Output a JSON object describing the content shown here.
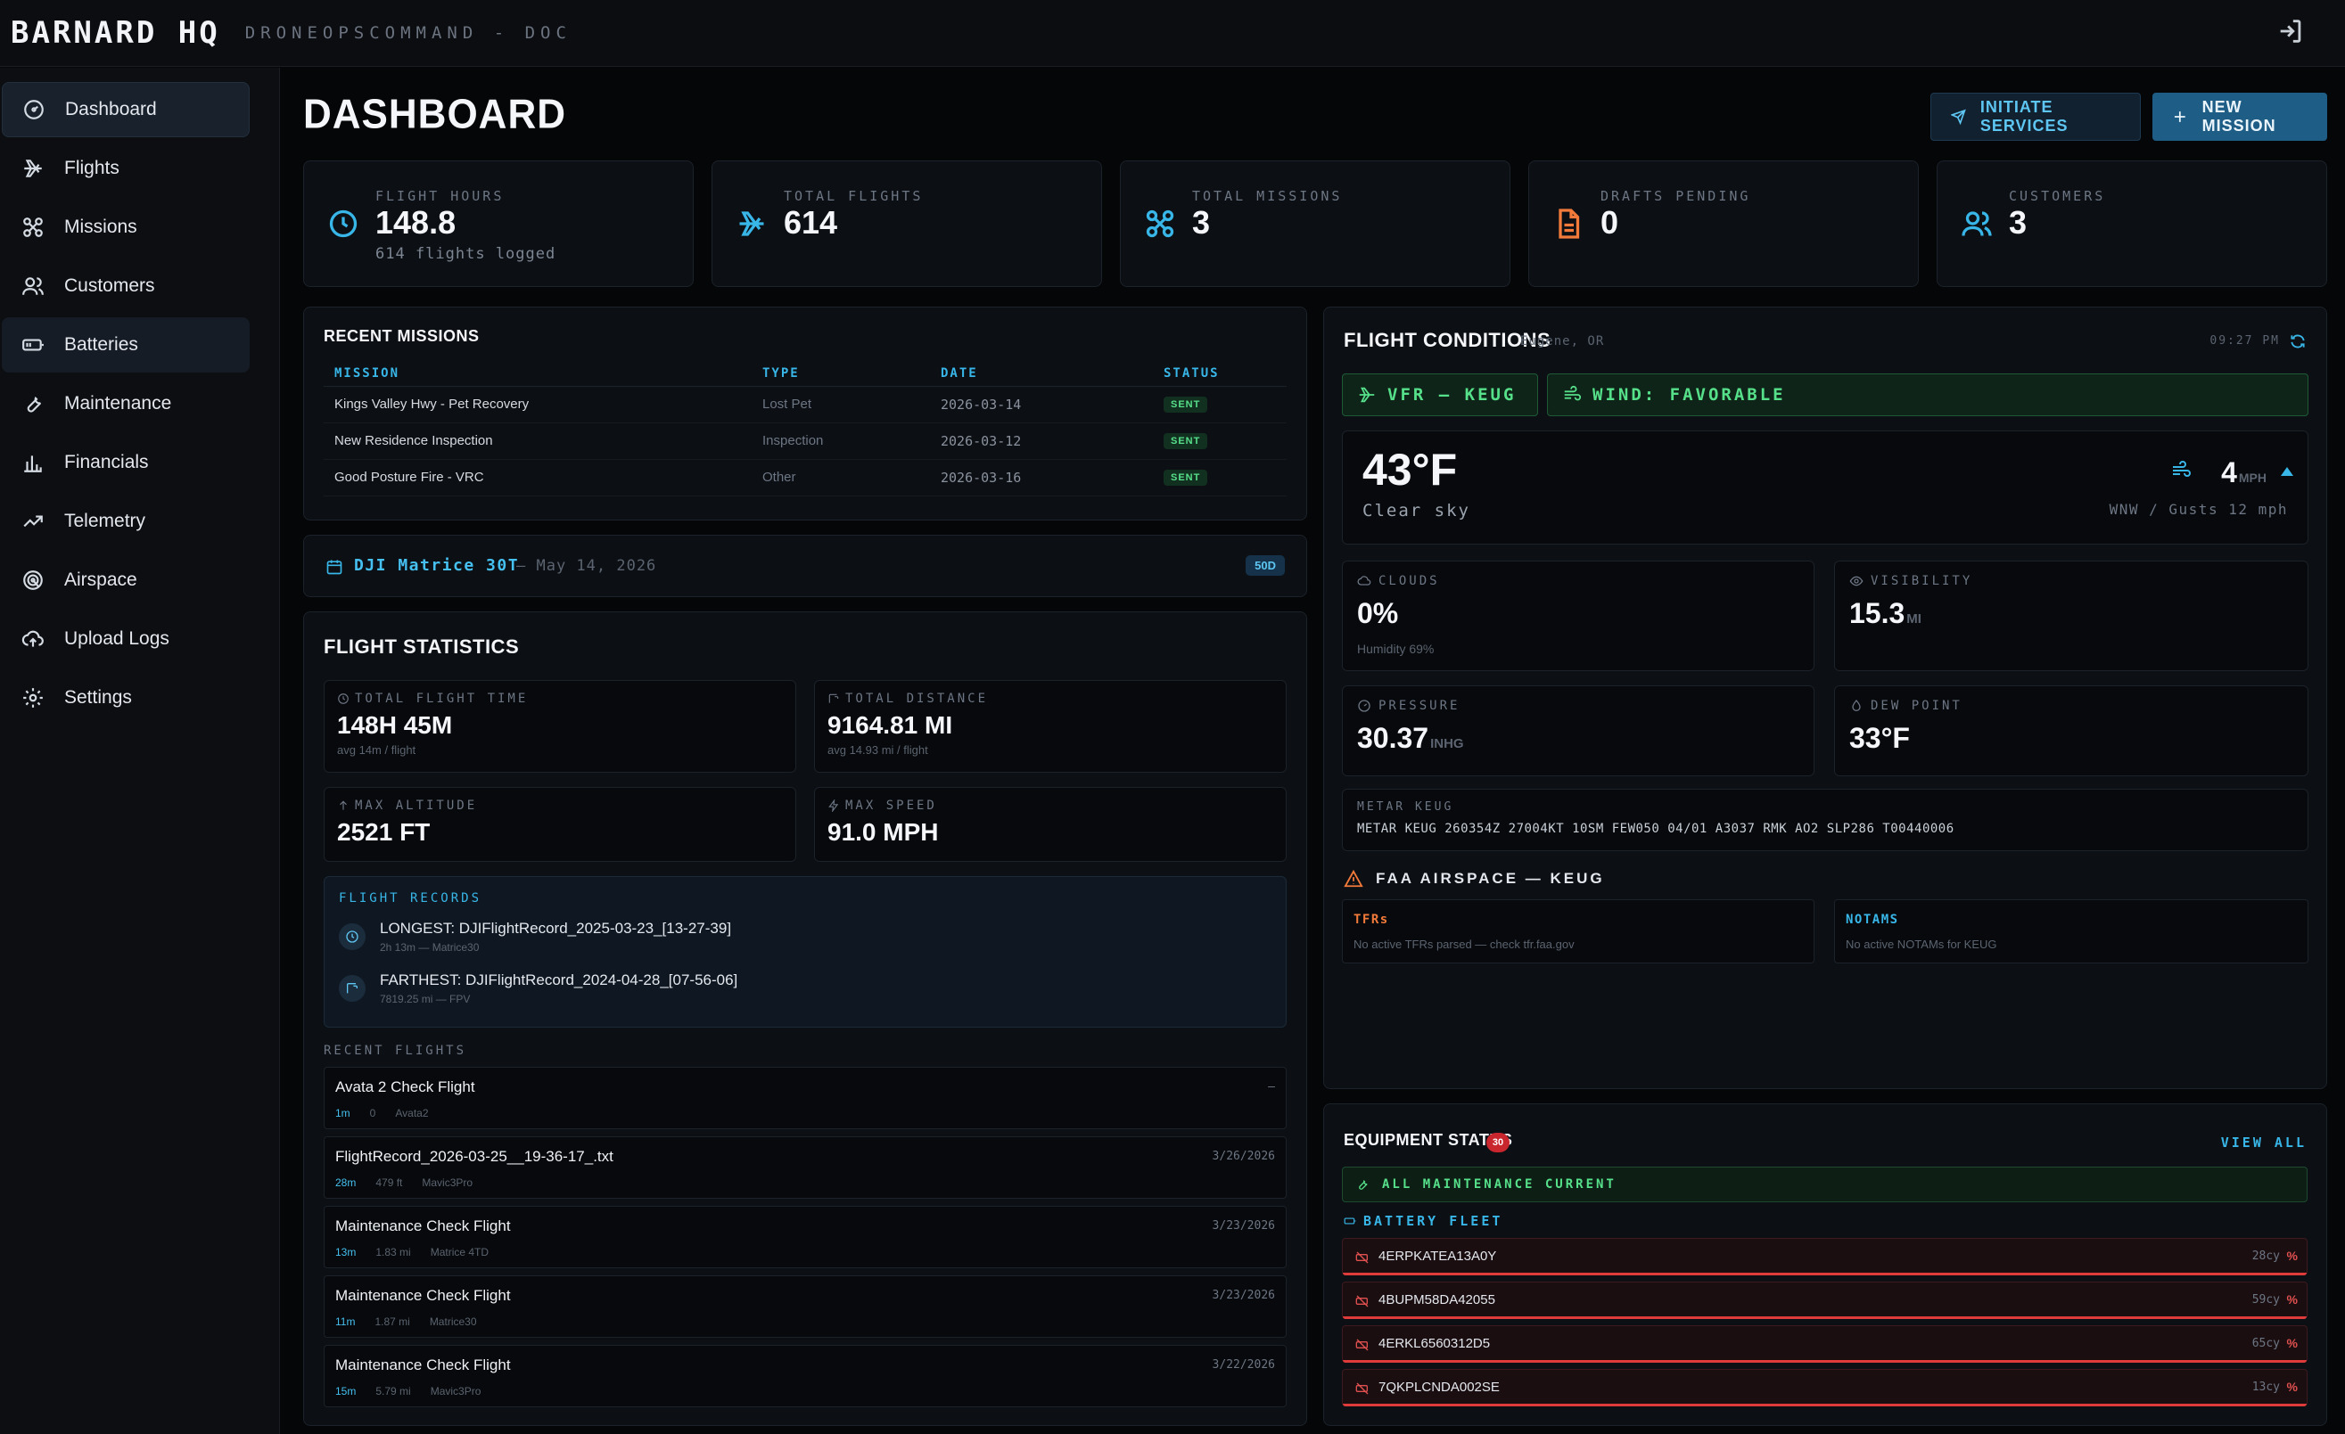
{
  "app": {
    "brand": "BARNARD HQ",
    "subtitle": "DRONEOPSCOMMAND - DOC"
  },
  "sidebar": {
    "items": [
      {
        "label": "Dashboard",
        "icon": "gauge-icon",
        "active": true
      },
      {
        "label": "Flights",
        "icon": "plane-icon"
      },
      {
        "label": "Missions",
        "icon": "drone-icon"
      },
      {
        "label": "Customers",
        "icon": "users-icon"
      },
      {
        "label": "Batteries",
        "icon": "battery-icon",
        "hover": true
      },
      {
        "label": "Maintenance",
        "icon": "wrench-icon"
      },
      {
        "label": "Financials",
        "icon": "bar-chart-icon"
      },
      {
        "label": "Telemetry",
        "icon": "trend-icon"
      },
      {
        "label": "Airspace",
        "icon": "radar-icon"
      },
      {
        "label": "Upload Logs",
        "icon": "cloud-upload-icon"
      },
      {
        "label": "Settings",
        "icon": "gear-icon"
      }
    ]
  },
  "header": {
    "title": "DASHBOARD",
    "initiate_label": "INITIATE SERVICES",
    "new_mission_label": "NEW MISSION"
  },
  "stats": [
    {
      "label": "FLIGHT HOURS",
      "value": "148.8",
      "sub": "614 flights logged",
      "icon": "clock-icon",
      "color": "#38b6e8"
    },
    {
      "label": "TOTAL FLIGHTS",
      "value": "614",
      "sub": "",
      "icon": "plane-icon",
      "color": "#38b6e8"
    },
    {
      "label": "TOTAL MISSIONS",
      "value": "3",
      "sub": "",
      "icon": "drone-icon",
      "color": "#38b6e8"
    },
    {
      "label": "DRAFTS PENDING",
      "value": "0",
      "sub": "",
      "icon": "document-icon",
      "color": "#f27a3a"
    },
    {
      "label": "CUSTOMERS",
      "value": "3",
      "sub": "",
      "icon": "users-icon",
      "color": "#38b6e8"
    }
  ],
  "recent_missions": {
    "title": "RECENT MISSIONS",
    "columns": [
      "MISSION",
      "TYPE",
      "DATE",
      "STATUS"
    ],
    "rows": [
      {
        "mission": "Kings Valley Hwy - Pet Recovery",
        "type": "Lost Pet",
        "date": "2026-03-14",
        "status": "SENT"
      },
      {
        "mission": "New Residence Inspection",
        "type": "Inspection",
        "date": "2026-03-12",
        "status": "SENT"
      },
      {
        "mission": "Good Posture Fire - VRC",
        "type": "Other",
        "date": "2026-03-16",
        "status": "SENT"
      }
    ]
  },
  "aircraft": {
    "name": "DJI Matrice 30T",
    "date": "— May 14, 2026",
    "badge": "50D"
  },
  "flight_statistics": {
    "title": "FLIGHT STATISTICS",
    "total_time": {
      "label": "TOTAL FLIGHT TIME",
      "value": "148H 45M",
      "sub": "avg 14m / flight"
    },
    "total_distance": {
      "label": "TOTAL DISTANCE",
      "value": "9164.81 MI",
      "sub": "avg 14.93 mi / flight"
    },
    "max_altitude": {
      "label": "MAX ALTITUDE",
      "value": "2521 FT"
    },
    "max_speed": {
      "label": "MAX SPEED",
      "value": "91.0 MPH"
    },
    "records_title": "FLIGHT RECORDS",
    "longest": {
      "main": "LONGEST: DJIFlightRecord_2025-03-23_[13-27-39]",
      "sub": "2h 13m — Matrice30"
    },
    "farthest": {
      "main": "FARTHEST: DJIFlightRecord_2024-04-28_[07-56-06]",
      "sub": "7819.25 mi — FPV"
    },
    "recent_title": "RECENT FLIGHTS",
    "recent": [
      {
        "name": "Avata 2 Check Flight",
        "duration": "1m",
        "distance": "0",
        "aircraft": "Avata2",
        "date": "—"
      },
      {
        "name": "FlightRecord_2026-03-25__19-36-17_.txt",
        "duration": "28m",
        "distance": "479 ft",
        "aircraft": "Mavic3Pro",
        "date": "3/26/2026"
      },
      {
        "name": "Maintenance Check Flight",
        "duration": "13m",
        "distance": "1.83 mi",
        "aircraft": "Matrice 4TD",
        "date": "3/23/2026"
      },
      {
        "name": "Maintenance Check Flight",
        "duration": "11m",
        "distance": "1.87 mi",
        "aircraft": "Matrice30",
        "date": "3/23/2026"
      },
      {
        "name": "Maintenance Check Flight",
        "duration": "15m",
        "distance": "5.79 mi",
        "aircraft": "Mavic3Pro",
        "date": "3/22/2026"
      }
    ]
  },
  "flight_conditions": {
    "title": "FLIGHT CONDITIONS",
    "location": "Eugene, OR",
    "time": "09:27 PM",
    "vfr": "VFR — KEUG",
    "wind_status": "WIND: FAVORABLE",
    "temperature": "43°F",
    "sky": "Clear sky",
    "wind_speed": "4",
    "wind_unit": "MPH",
    "wind_detail": "WNW / Gusts 12 mph",
    "clouds": {
      "label": "CLOUDS",
      "value": "0%",
      "sub": "Humidity 69%"
    },
    "visibility": {
      "label": "VISIBILITY",
      "value": "15.3",
      "unit": "MI"
    },
    "pressure": {
      "label": "PRESSURE",
      "value": "30.37",
      "unit": "INHG"
    },
    "dew_point": {
      "label": "DEW POINT",
      "value": "33°F"
    },
    "metar_label": "METAR KEUG",
    "metar_text": "METAR KEUG 260354Z 27004KT 10SM FEW050 04/01 A3037 RMK AO2 SLP286 T00440006",
    "faa_title": "FAA AIRSPACE — KEUG",
    "tfr_label": "TFRs",
    "tfr_text": "No active TFRs parsed — check tfr.faa.gov",
    "notam_label": "NOTAMS",
    "notam_text": "No active NOTAMs for KEUG"
  },
  "equipment": {
    "title": "EQUIPMENT STATUS",
    "count": "30",
    "view_all": "VIEW ALL",
    "maintenance": "ALL MAINTENANCE CURRENT",
    "fleet_title": "BATTERY FLEET",
    "batteries": [
      {
        "id": "4ERPKATEA13A0Y",
        "cycles": "28cy",
        "pct": "%"
      },
      {
        "id": "4BUPM58DA42055",
        "cycles": "59cy",
        "pct": "%"
      },
      {
        "id": "4ERKL6560312D5",
        "cycles": "65cy",
        "pct": "%"
      },
      {
        "id": "7QKPLCNDA002SE",
        "cycles": "13cy",
        "pct": "%"
      }
    ]
  }
}
